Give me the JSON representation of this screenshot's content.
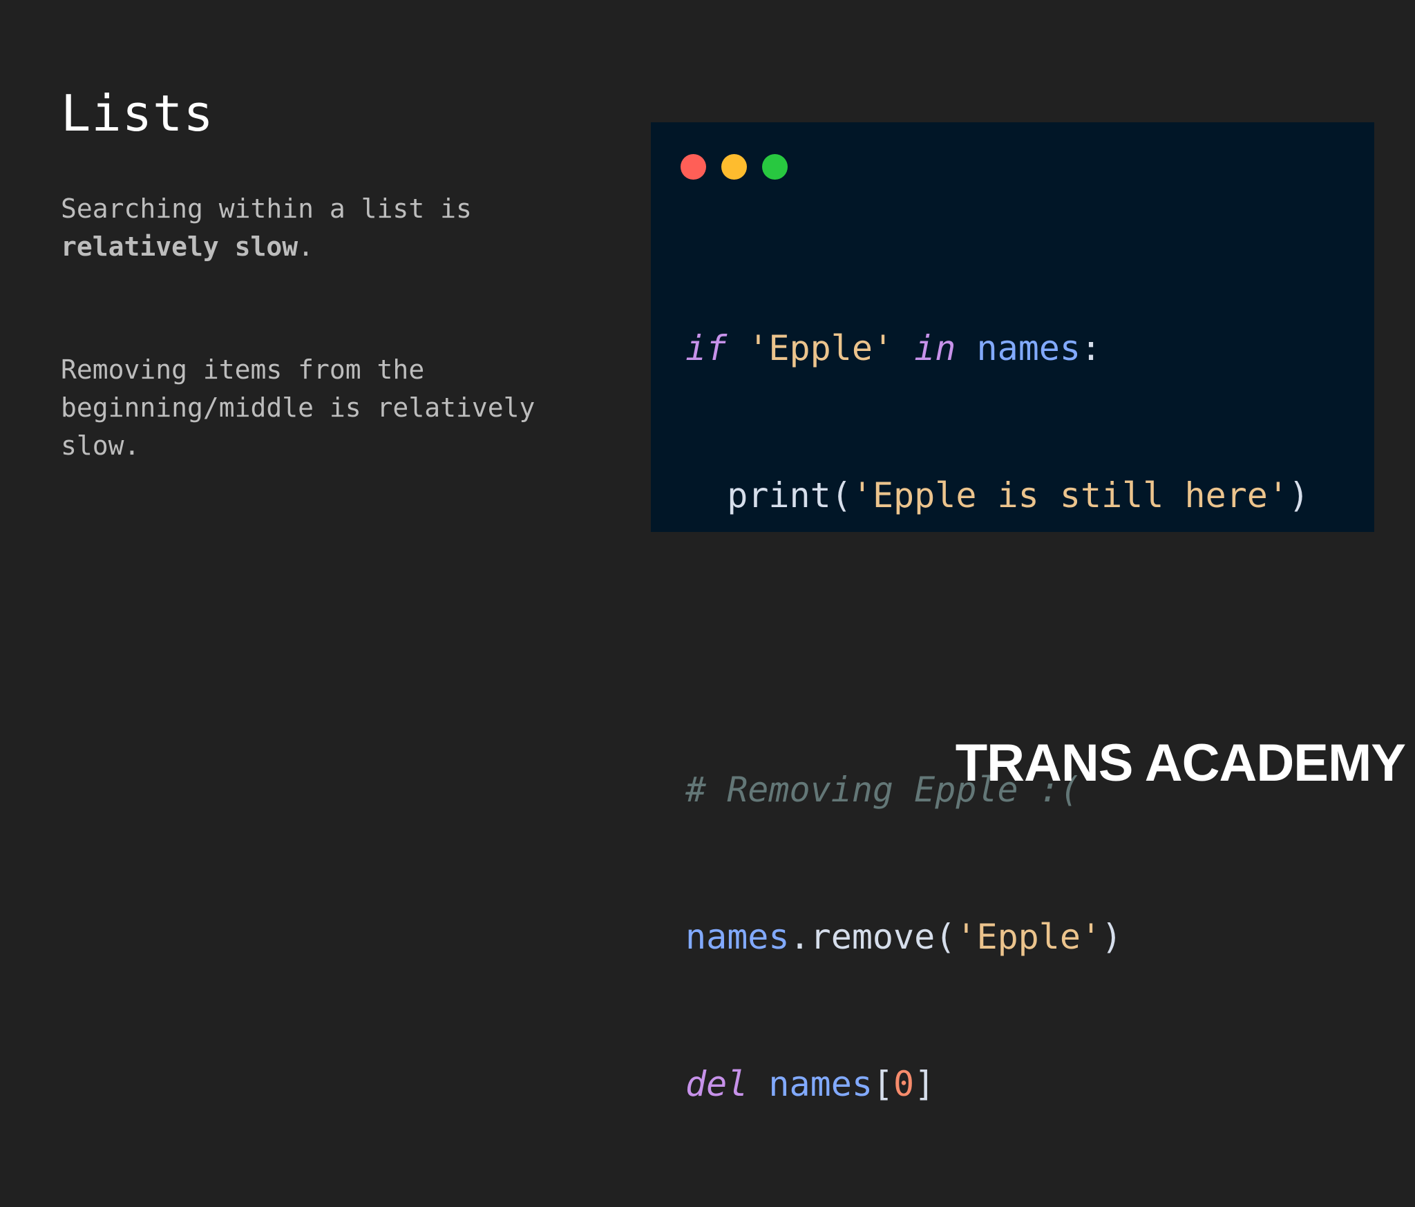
{
  "slide": {
    "title": "Lists",
    "paragraph1": {
      "text_before": "Searching within a list is ",
      "bold_text": "relatively slow",
      "text_after": "."
    },
    "paragraph2": {
      "text": "Removing items from the beginning/middle is relatively slow."
    }
  },
  "code_window": {
    "window_controls": [
      "close-dot",
      "minimize-dot",
      "maximize-dot"
    ],
    "colors": {
      "background": "#011627",
      "close": "#ff5f57",
      "minimize": "#febc2e",
      "maximize": "#28c840"
    },
    "lines": {
      "l1": {
        "kw1": "if",
        "str1": "'Epple'",
        "kw2": "in",
        "var1": "names",
        "punc1": ":"
      },
      "l2": {
        "func": "print",
        "punc_open": "(",
        "str": "'Epple is still here'",
        "punc_close": ")"
      },
      "l4": {
        "comment": "# Removing Epple :("
      },
      "l5": {
        "var": "names",
        "dot": ".",
        "method": "remove",
        "punc_open": "(",
        "str": "'Epple'",
        "punc_close": ")"
      },
      "l6": {
        "kw": "del",
        "var": "names",
        "bracket_open": "[",
        "num": "0",
        "bracket_close": "]"
      }
    }
  },
  "branding": {
    "logo_text": "TRANS ACADEMY"
  }
}
